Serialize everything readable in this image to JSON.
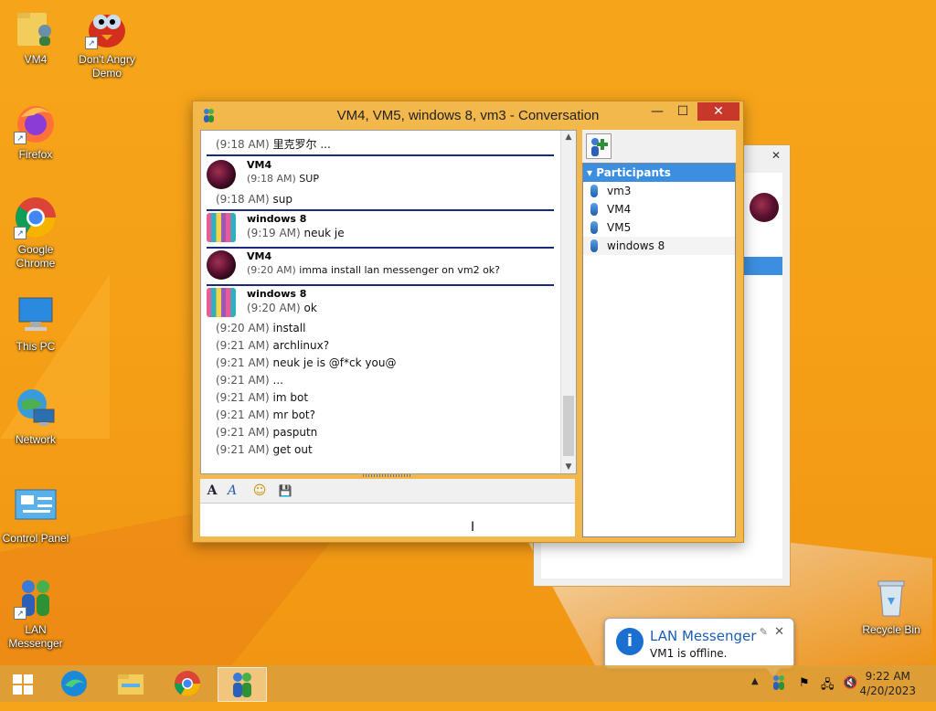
{
  "desktop": {
    "icons": [
      {
        "label": "VM4",
        "icon": "folder-user-icon"
      },
      {
        "label": "Don't Angry Demo",
        "icon": "angry-bird-icon"
      },
      {
        "label": "Firefox",
        "icon": "firefox-icon"
      },
      {
        "label": "Google Chrome",
        "icon": "chrome-icon"
      },
      {
        "label": "This PC",
        "icon": "computer-icon"
      },
      {
        "label": "Network",
        "icon": "network-icon"
      },
      {
        "label": "Control Panel",
        "icon": "control-panel-icon"
      },
      {
        "label": "LAN Messenger",
        "icon": "lan-messenger-icon"
      },
      {
        "label": "Recycle Bin",
        "icon": "recycle-bin-icon"
      }
    ]
  },
  "window": {
    "title": "VM4, VM5, windows 8, vm3 - Conversation",
    "minimize": "—",
    "maximize": "☐",
    "close": "✕"
  },
  "chat": {
    "messages": [
      {
        "time": "(9:18 AM)",
        "text": "里克罗尔 ..."
      },
      {
        "sender": "VM4",
        "time": "(9:18 AM)",
        "text": "SUP"
      },
      {
        "time": "(9:18 AM)",
        "text": "sup"
      },
      {
        "sender": "windows 8",
        "time": "(9:19 AM)",
        "text": "neuk je"
      },
      {
        "sender": "VM4",
        "time": "(9:20 AM)",
        "text": "imma install lan messenger on vm2 ok?"
      },
      {
        "sender": "windows 8",
        "time": "(9:20 AM)",
        "text": "ok"
      },
      {
        "time": "(9:20 AM)",
        "text": "install"
      },
      {
        "time": "(9:21 AM)",
        "text": "archlinux?"
      },
      {
        "time": "(9:21 AM)",
        "text": "neuk je is @f*ck you@"
      },
      {
        "time": "(9:21 AM)",
        "text": "..."
      },
      {
        "time": "(9:21 AM)",
        "text": "im bot"
      },
      {
        "time": "(9:21 AM)",
        "text": "mr bot?"
      },
      {
        "time": "(9:21 AM)",
        "text": "pasputn"
      },
      {
        "time": "(9:21 AM)",
        "text": "get out"
      }
    ]
  },
  "toolbar": {
    "font": "A",
    "font_style": "A",
    "emoji": "☺",
    "save": "💾"
  },
  "participants": {
    "header": "Participants",
    "list": [
      "vm3",
      "VM4",
      "VM5",
      "windows 8"
    ]
  },
  "notification": {
    "title": "LAN Messenger",
    "body": "VM1 is offline.",
    "close": "✕"
  },
  "taskbar": {
    "time": "9:22 AM",
    "date": "4/20/2023"
  },
  "colors": {
    "accent": "#3c8ee0",
    "separator": "#1a2a7a",
    "close": "#c7382b"
  }
}
